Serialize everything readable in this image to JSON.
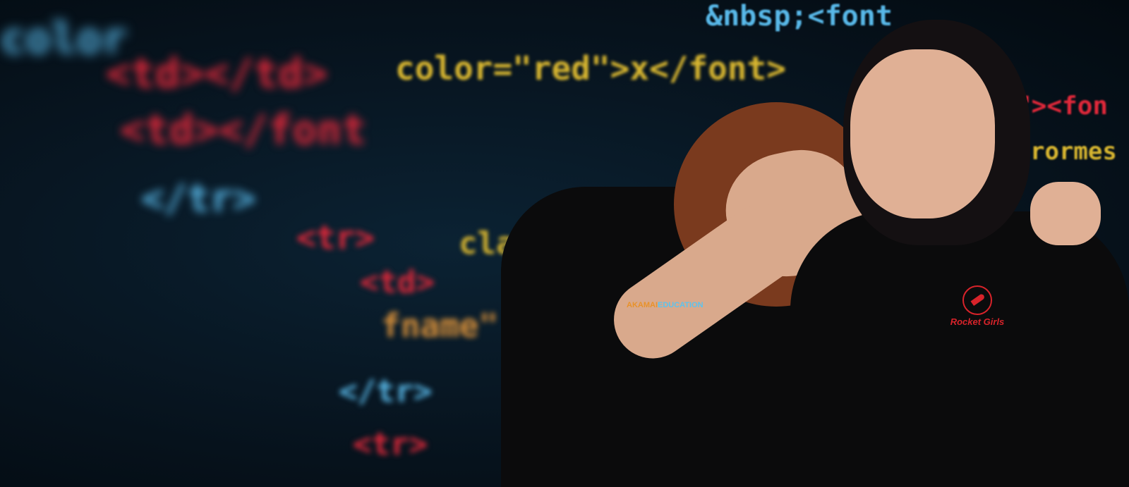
{
  "background_code": {
    "line1": "&nbsp;<font",
    "line2": "color=\"red\">x</font>",
    "line3": "<td></td>",
    "line4": "<td></font",
    "line5": "</tr>",
    "line6": "<tr>",
    "line7": "class",
    "line8": "<td>",
    "line9": "fname\"",
    "line10": "</tr>",
    "line11": "<tr>",
    "line12": "color",
    "line13": "\"><fon",
    "line14": "rormes"
  },
  "logos": {
    "akamai_part1": "AKAMAI",
    "akamai_part2": "EDUCATION",
    "rocket_girls": "Rocket Girls"
  },
  "colors": {
    "background": "#06121c",
    "code_blue": "#58b8e8",
    "code_red": "#e0283a",
    "code_yellow": "#d8b630",
    "logo_red": "#d8232a"
  }
}
